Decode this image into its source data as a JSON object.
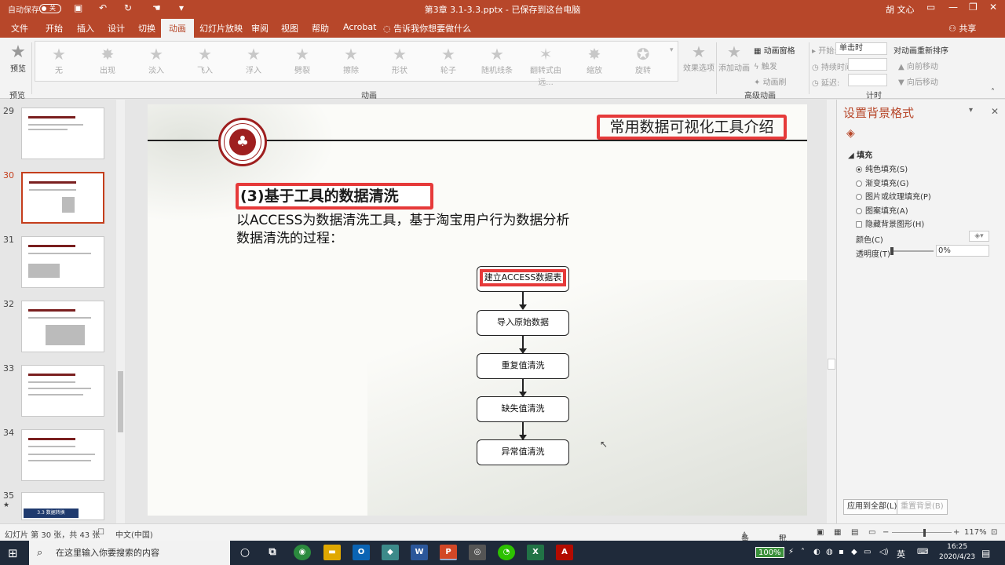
{
  "titlebar": {
    "autosave_label": "自动保存",
    "autosave_state": "关",
    "doc_title": "第3章 3.1-3.3.pptx - 已保存到这台电脑",
    "user": "胡 文心"
  },
  "tabs": [
    "文件",
    "开始",
    "插入",
    "设计",
    "切换",
    "动画",
    "幻灯片放映",
    "审阅",
    "视图",
    "帮助",
    "Acrobat"
  ],
  "active_tab": "动画",
  "tell_me": "告诉我你想要做什么",
  "share": "共享",
  "ribbon": {
    "preview": {
      "label": "预览",
      "group": "预览"
    },
    "animations": [
      "无",
      "出现",
      "淡入",
      "飞入",
      "浮入",
      "劈裂",
      "擦除",
      "形状",
      "轮子",
      "随机线条",
      "翻转式由远...",
      "缩放",
      "旋转"
    ],
    "animations_group": "动画",
    "effect_options": "效果选项",
    "add_animation": "添加动画",
    "animation_pane": "动画窗格",
    "trigger": "触发",
    "animation_painter": "动画刷",
    "advanced_group": "高级动画",
    "start_label": "开始:",
    "start_value": "单击时",
    "duration_label": "持续时间:",
    "delay_label": "延迟:",
    "reorder_title": "对动画重新排序",
    "move_earlier": "向前移动",
    "move_later": "向后移动",
    "timing_group": "计时"
  },
  "thumbnails": [
    {
      "num": "29"
    },
    {
      "num": "30"
    },
    {
      "num": "31"
    },
    {
      "num": "32"
    },
    {
      "num": "33"
    },
    {
      "num": "34"
    },
    {
      "num": "35",
      "caption": "3.3 数据转换"
    }
  ],
  "selected_slide": "30",
  "slide": {
    "title": "常用数据可视化工具介绍",
    "section_heading": "(3)基于工具的数据清洗",
    "description": "以ACCESS为数据清洗工具，基于淘宝用户行为数据分析数据清洗的过程：",
    "flow": [
      "建立ACCESS数据表",
      "导入原始数据",
      "重复值清洗",
      "缺失值清洗",
      "异常值清洗"
    ]
  },
  "format_pane": {
    "title": "设置背景格式",
    "fill_header": "填充",
    "options": [
      "纯色填充(S)",
      "渐变填充(G)",
      "图片或纹理填充(P)",
      "图案填充(A)",
      "隐藏背景图形(H)"
    ],
    "selected_option": "纯色填充(S)",
    "color_label": "颜色(C)",
    "transparency_label": "透明度(T)",
    "transparency_value": "0%",
    "apply_all": "应用到全部(L)",
    "reset_background": "重置背景(B)"
  },
  "status": {
    "slide_info": "幻灯片 第 30 张，共 43 张",
    "language": "中文(中国)",
    "notes": "备注",
    "comments": "批注",
    "zoom": "117%"
  },
  "taskbar": {
    "search_placeholder": "在这里输入你要搜索的内容",
    "battery": "100%",
    "ime": "英",
    "time": "16:25",
    "date": "2020/4/23"
  }
}
